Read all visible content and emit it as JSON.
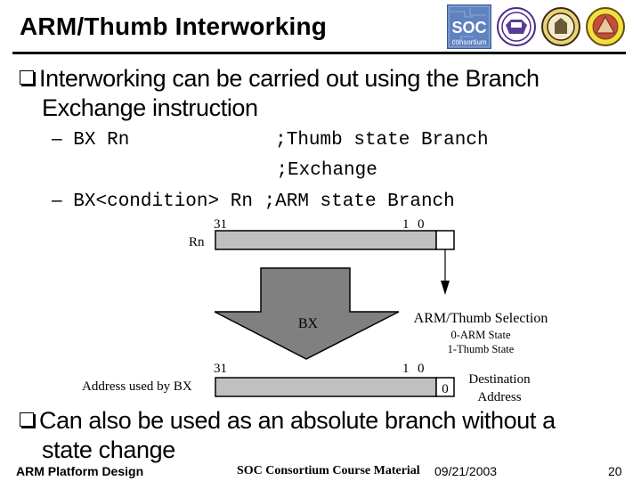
{
  "slide": {
    "title": "ARM/Thumb Interworking",
    "logos": [
      "soc-consortium-logo",
      "university-seal-1",
      "university-seal-2",
      "university-seal-3"
    ],
    "logo_text": {
      "soc": "SOC",
      "consortium": "consortium"
    },
    "bullets": [
      {
        "text": "Interworking can be carried out using the Branch Exchange instruction",
        "line1": "Interworking can be carried out using the Branch",
        "line2": "Exchange instruction"
      },
      {
        "text": "Can also be used as an absolute branch without a state change",
        "line1": "Can also be used as an absolute branch without a",
        "line2": "state change"
      }
    ],
    "code_lines": [
      {
        "dash": "–",
        "code": " BX Rn             ;Thumb state Branch"
      },
      {
        "dash": "",
        "code": "                   ;Exchange"
      },
      {
        "dash": "–",
        "code": " BX<condition> Rn ;ARM state Branch"
      }
    ],
    "diagram": {
      "top_register_label": "Rn",
      "bit_high": "31",
      "bit_one": "1",
      "bit_zero": "0",
      "arrow_label": "BX",
      "selection_title": "ARM/Thumb Selection",
      "selection_0": "0-ARM State",
      "selection_1": "1-Thumb State",
      "bottom_register_label": "Address used by BX",
      "bottom_bit0_value": "0",
      "dest_line1": "Destination",
      "dest_line2": "Address",
      "colors": {
        "bar": "#c0c0c0",
        "arrow": "#808080"
      }
    },
    "footer": {
      "left": "ARM Platform Design",
      "center": "SOC Consortium Course Material",
      "date": "09/21/2003",
      "page": "20"
    }
  }
}
